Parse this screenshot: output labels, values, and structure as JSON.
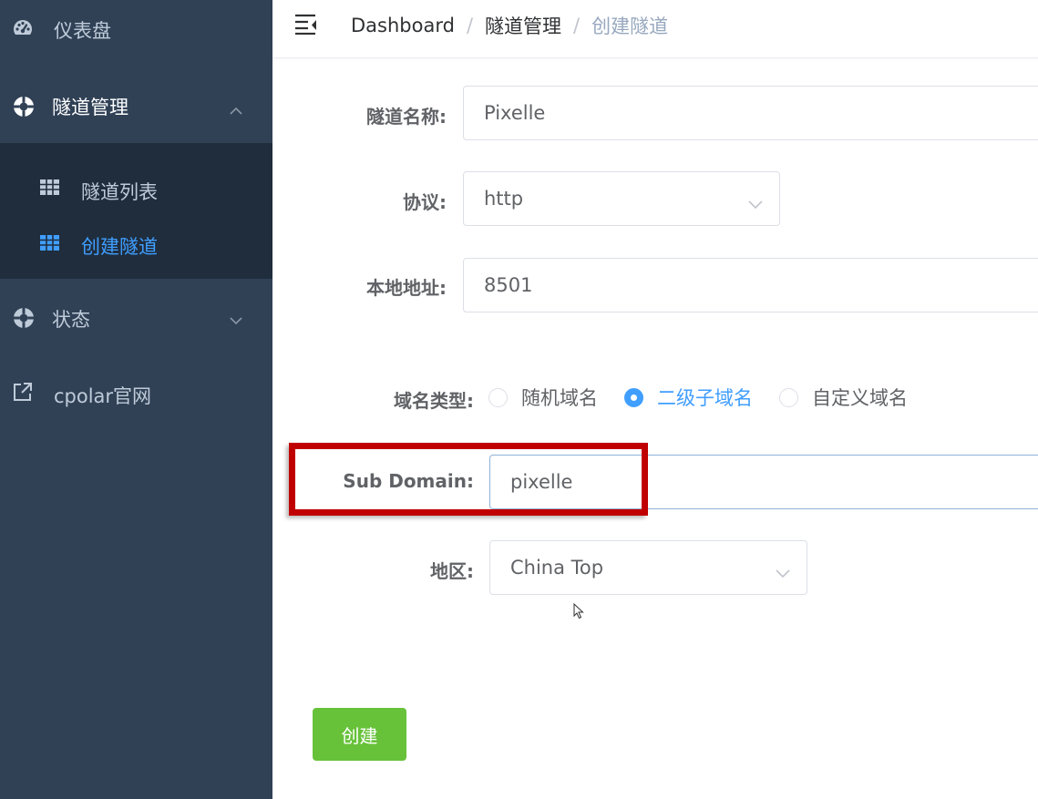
{
  "sidebar": {
    "dashboard_label": "仪表盘",
    "tunnel_mgmt_label": "隧道管理",
    "tunnel_list_label": "隧道列表",
    "create_tunnel_label": "创建隧道",
    "status_label": "状态",
    "cpolar_site_label": "cpolar官网",
    "colors": {
      "bg": "#304156",
      "submenu_bg": "#1f2d3d",
      "active": "#409eff",
      "text": "#bfcbd9"
    }
  },
  "header": {
    "breadcrumb": [
      "Dashboard",
      "隧道管理",
      "创建隧道"
    ],
    "separator": "/"
  },
  "form": {
    "tunnel_name": {
      "label": "隧道名称:",
      "value": "Pixelle"
    },
    "protocol": {
      "label": "协议:",
      "value": "http"
    },
    "local_address": {
      "label": "本地地址:",
      "value": "8501"
    },
    "domain_type": {
      "label": "域名类型:",
      "options": [
        "随机域名",
        "二级子域名",
        "自定义域名"
      ],
      "selected": "二级子域名"
    },
    "sub_domain": {
      "label": "Sub Domain:",
      "value": "pixelle"
    },
    "region": {
      "label": "地区:",
      "value": "China Top"
    },
    "submit_label": "创建"
  },
  "icons": {
    "dashboard": "gauge-icon",
    "tunnel": "lifebuoy-icon",
    "list": "grid-icon",
    "status": "lifebuoy-icon",
    "external": "external-link-icon",
    "menu_toggle": "hamburger-icon",
    "caret": "chevron-down-icon"
  },
  "accent_colors": {
    "primary": "#409eff",
    "success": "#67c23a",
    "highlight": "#c00000"
  }
}
